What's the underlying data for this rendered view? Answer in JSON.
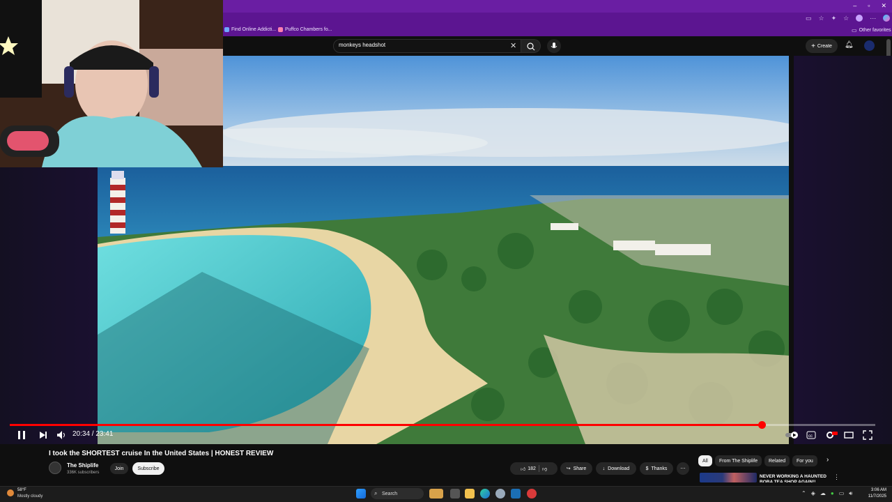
{
  "browser": {
    "bookmarks": [
      {
        "label": "Find Online Addicti...",
        "color": "#6fa8ff"
      },
      {
        "label": "Puffco Chambers fo...",
        "color": "#ff7fb0"
      }
    ],
    "other_favorites": "Other favorites"
  },
  "youtube": {
    "search_query": "monkeys headshot",
    "create_label": "Create",
    "video": {
      "title": "I took the SHORTEST cruise In the United States | HONEST REVIEW",
      "time_current": "20:34",
      "time_total": "23:41",
      "time_display": "20:34 / 23:41",
      "progress_fraction": 0.869
    },
    "channel": {
      "name": "The Shiplife",
      "subscribers": "336K subscribers",
      "join_label": "Join",
      "subscribe_label": "Subscribe"
    },
    "actions": {
      "likes": "182",
      "share": "Share",
      "download": "Download",
      "thanks": "Thanks"
    },
    "chips": [
      "All",
      "From The Shiplife",
      "Related",
      "For you"
    ],
    "recommendation": {
      "title": "NEVER WORKING A HAUNTED BOBA TEA SHOP AGAIN!!"
    }
  },
  "taskbar": {
    "weather_temp": "58°F",
    "weather_desc": "Mostly cloudy",
    "search_label": "Search",
    "time": "3:06 AM",
    "date": "11/7/2025"
  },
  "colors": {
    "browser_accent": "#6a1ea3",
    "progress": "#ff0000"
  }
}
